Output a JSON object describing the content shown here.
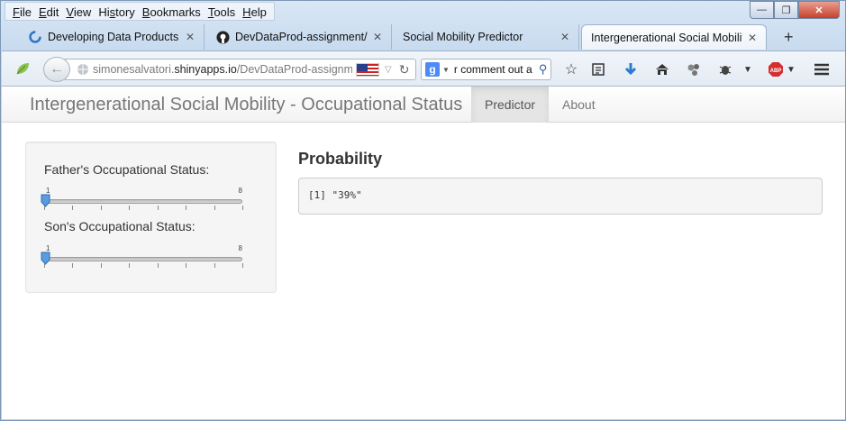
{
  "menubar": {
    "items": [
      {
        "accel": "F",
        "rest": "ile"
      },
      {
        "accel": "E",
        "rest": "dit"
      },
      {
        "accel": "V",
        "rest": "iew"
      },
      {
        "pre": "Hi",
        "accel": "s",
        "rest": "tory"
      },
      {
        "accel": "B",
        "rest": "ookmarks"
      },
      {
        "accel": "T",
        "rest": "ools"
      },
      {
        "accel": "H",
        "rest": "elp"
      }
    ]
  },
  "window_controls": {
    "minimize": "—",
    "maximize": "❐",
    "close": "✕"
  },
  "tabs": [
    {
      "label": "Developing Data Products |...",
      "icon": "coursera-icon"
    },
    {
      "label": "DevDataProd-assignment/...",
      "icon": "github-icon"
    },
    {
      "label": "Social Mobility Predictor",
      "icon": "none"
    },
    {
      "label": "Intergenerational Social Mobilit...",
      "icon": "none",
      "active": true
    }
  ],
  "new_tab": "+",
  "urlbar": {
    "prefix": "simonesalvatori.",
    "domain": "shinyapps.io",
    "path": "/DevDataProd-assignmer"
  },
  "search": {
    "engine": "g",
    "text": "r comment out a"
  },
  "app": {
    "brand": "Intergenerational Social Mobility - Occupational Status",
    "nav": {
      "predictor": "Predictor",
      "about": "About"
    },
    "father": {
      "label": "Father's Occupational Status:",
      "min": "1",
      "max": "8",
      "value": 1
    },
    "son": {
      "label": "Son's Occupational Status:",
      "min": "1",
      "max": "8",
      "value": 1
    },
    "main_title": "Probability",
    "output": "[1] \"39%\""
  },
  "colors": {
    "accent_handle": "#5b9be0",
    "navbar_active": "#e5e5e5",
    "well": "#f5f5f5"
  }
}
